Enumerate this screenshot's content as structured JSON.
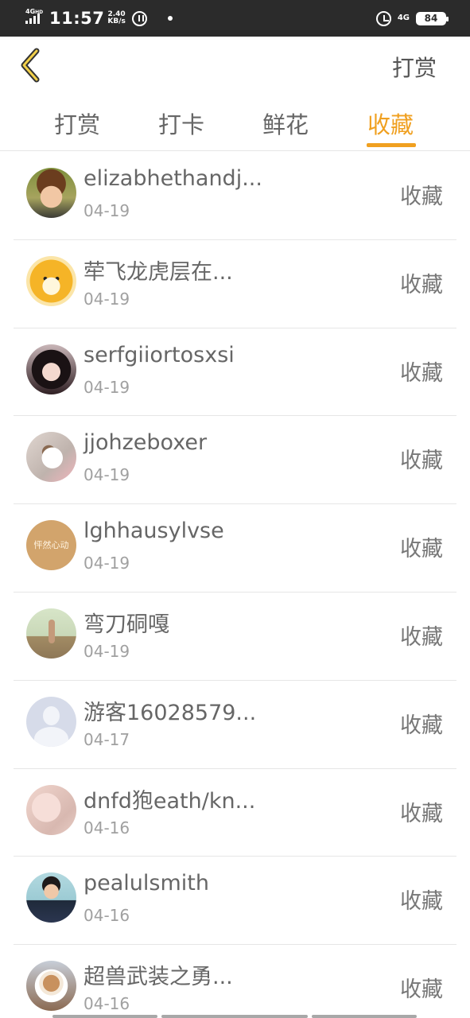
{
  "status_bar": {
    "network_left": "4G",
    "network_left_sup": "HD",
    "time": "11:57",
    "speed_value": "2.40",
    "speed_unit": "KB/s",
    "network_right": "4G",
    "battery": "84"
  },
  "header": {
    "action_label": "打赏"
  },
  "tabs": [
    {
      "label": "打赏",
      "active": false
    },
    {
      "label": "打卡",
      "active": false
    },
    {
      "label": "鲜花",
      "active": false
    },
    {
      "label": "收藏",
      "active": true
    }
  ],
  "accent_color": "#f0a020",
  "list": [
    {
      "name": "elizabhethandj...",
      "date": "04-19",
      "action": "收藏",
      "avatar": "photo-boy"
    },
    {
      "name": "荦飞龙虎层在...",
      "date": "04-19",
      "action": "收藏",
      "avatar": "cartoon-dog"
    },
    {
      "name": "serfgiiortosxsi",
      "date": "04-19",
      "action": "收藏",
      "avatar": "photo-girl"
    },
    {
      "name": "jjohzeboxer",
      "date": "04-19",
      "action": "收藏",
      "avatar": "photo-cat"
    },
    {
      "name": "lghhausylvse",
      "date": "04-19",
      "action": "收藏",
      "avatar": "gold-text",
      "avatar_text": "怦然心动"
    },
    {
      "name": "弯刀硐嘎",
      "date": "04-19",
      "action": "收藏",
      "avatar": "photo-beach"
    },
    {
      "name": "游客16028579...",
      "date": "04-17",
      "action": "收藏",
      "avatar": "default-user"
    },
    {
      "name": "dnfd狍eath/kn...",
      "date": "04-16",
      "action": "收藏",
      "avatar": "photo-skin"
    },
    {
      "name": "pealulsmith",
      "date": "04-16",
      "action": "收藏",
      "avatar": "photo-man"
    },
    {
      "name": "超兽武装之勇...",
      "date": "04-16",
      "action": "收藏",
      "avatar": "photo-coffee"
    }
  ]
}
